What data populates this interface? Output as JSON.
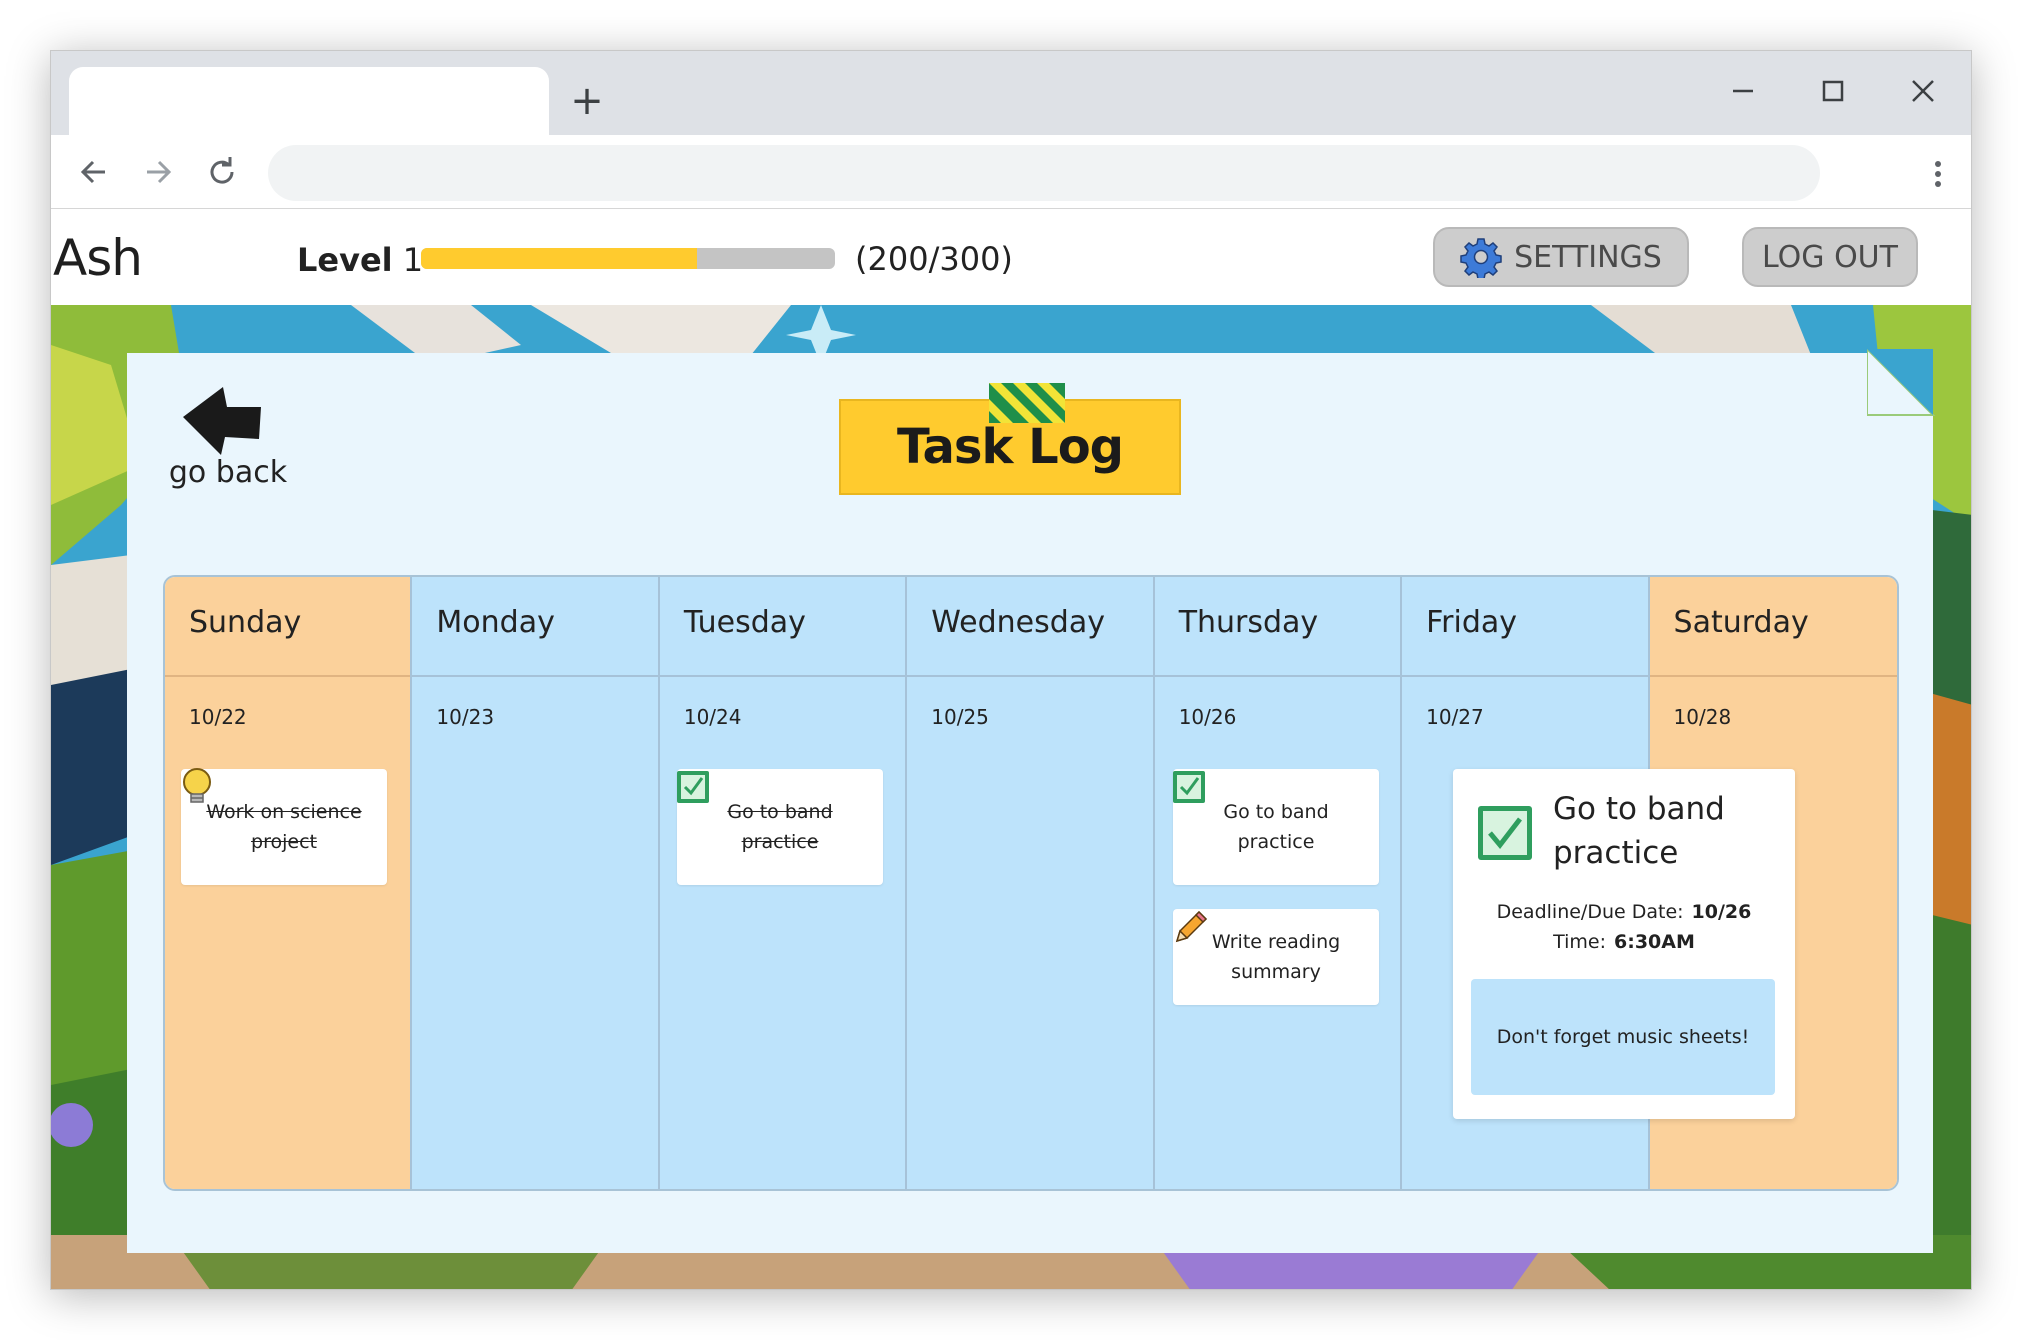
{
  "browser": {
    "new_tab_symbol": "+",
    "icons": [
      "back-arrow-icon",
      "forward-arrow-icon",
      "reload-icon",
      "kebab-menu-icon",
      "minimize-icon",
      "maximize-icon",
      "close-icon"
    ]
  },
  "header": {
    "username": "Ash",
    "level_prefix": "Level",
    "level_number": "1",
    "xp_progress_fraction": 0.6667,
    "xp_text": "(200/300)",
    "settings_label": "SETTINGS",
    "logout_label": "LOG OUT",
    "settings_icon": "gear-icon"
  },
  "panel": {
    "go_back_label": "go back",
    "go_back_icon": "left-arrow-icon",
    "title": "Task Log"
  },
  "calendar": {
    "days": [
      {
        "name": "Sunday",
        "date": "10/22",
        "weekend": true
      },
      {
        "name": "Monday",
        "date": "10/23",
        "weekend": false
      },
      {
        "name": "Tuesday",
        "date": "10/24",
        "weekend": false
      },
      {
        "name": "Wednesday",
        "date": "10/25",
        "weekend": false
      },
      {
        "name": "Thursday",
        "date": "10/26",
        "weekend": false
      },
      {
        "name": "Friday",
        "date": "10/27",
        "weekend": false
      },
      {
        "name": "Saturday",
        "date": "10/28",
        "weekend": true
      }
    ],
    "tasks": {
      "sunday_task": {
        "text": "Work on science project",
        "status": "completed",
        "icon": "lightbulb-icon"
      },
      "tuesday_task": {
        "text": "Go to band practice",
        "status": "completed",
        "icon": "checkbox-checked-icon"
      },
      "thursday_task_1": {
        "text": "Go to band practice",
        "status": "checked",
        "icon": "checkbox-checked-icon"
      },
      "thursday_task_2": {
        "text": "Write reading summary",
        "status": "in-progress",
        "icon": "pencil-icon"
      }
    },
    "detail": {
      "title": "Go to band practice",
      "deadline_label": "Deadline/Due Date:",
      "deadline_value": "10/26",
      "time_label": "Time:",
      "time_value": "6:30AM",
      "note": "Don't forget music sheets!",
      "icon": "checkbox-checked-icon"
    }
  },
  "colors": {
    "accent_yellow": "#ffcb2e",
    "weekday_blue": "#bde3fb",
    "weekend_orange": "#fbd19b",
    "panel_bg": "#eaf6fd",
    "check_green": "#2f9e5e"
  }
}
